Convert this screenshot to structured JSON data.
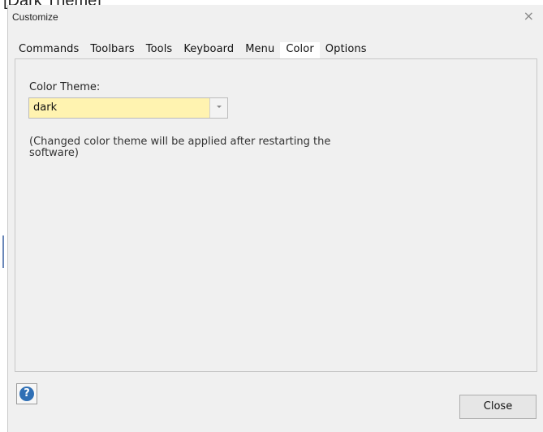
{
  "fragment_text": "[Dark Theme]",
  "window": {
    "title": "Customize",
    "close_glyph": "×"
  },
  "tabs": [
    {
      "label": "Commands",
      "active": false
    },
    {
      "label": "Toolbars",
      "active": false
    },
    {
      "label": "Tools",
      "active": false
    },
    {
      "label": "Keyboard",
      "active": false
    },
    {
      "label": "Menu",
      "active": false
    },
    {
      "label": "Color",
      "active": true
    },
    {
      "label": "Options",
      "active": false
    }
  ],
  "color_page": {
    "theme_label": "Color Theme:",
    "theme_value": "dark",
    "note": "(Changed color theme will be applied after restarting the software)"
  },
  "footer": {
    "help_glyph": "?",
    "close_label": "Close"
  },
  "colors": {
    "dialog_bg": "#f0f0f0",
    "combo_bg": "#fff3b0",
    "help_blue": "#2f6fb5"
  },
  "icons": {
    "close": "close-icon",
    "dropdown": "chevron-down-icon",
    "help": "help-icon"
  }
}
